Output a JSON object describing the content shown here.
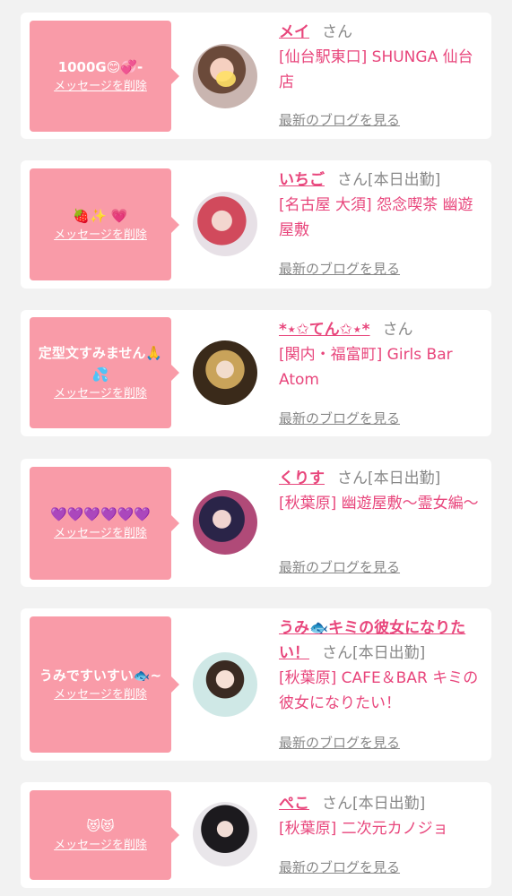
{
  "colors": {
    "accent": "#e8467c",
    "bubble": "#f99ba8",
    "muted": "#888888"
  },
  "common": {
    "delete_label": "メッセージを削除",
    "blog_label": "最新のブログを見る",
    "san": "さん"
  },
  "cards": [
    {
      "message": "1000G😊💞-",
      "name": "メイ",
      "status": "",
      "shop": "[仙台駅東口] SHUNGA 仙台店"
    },
    {
      "message": "🍓✨ 💗",
      "name": "いちご",
      "status": "[本日出勤]",
      "shop": "[名古屋 大須] 怨念喫茶 幽遊屋敷"
    },
    {
      "message": "定型文すみません🙏💦",
      "name": "*⋆✩てん✩⋆*",
      "status": "",
      "shop": "[関内・福富町] Girls Bar Atom"
    },
    {
      "message": "💜💜💜💜💜💜",
      "name": "くりす",
      "status": "[本日出勤]",
      "shop": "[秋葉原] 幽遊屋敷〜霊女編〜"
    },
    {
      "message": "うみですいすい🐟~",
      "name": "うみ🐟キミの彼女になりたい！",
      "status": "[本日出勤]",
      "shop": "[秋葉原] CAFE＆BAR キミの彼女になりたい！"
    },
    {
      "message": "😻😻",
      "name": "ぺこ",
      "status": "[本日出勤]",
      "shop": "[秋葉原] 二次元カノジョ"
    }
  ]
}
